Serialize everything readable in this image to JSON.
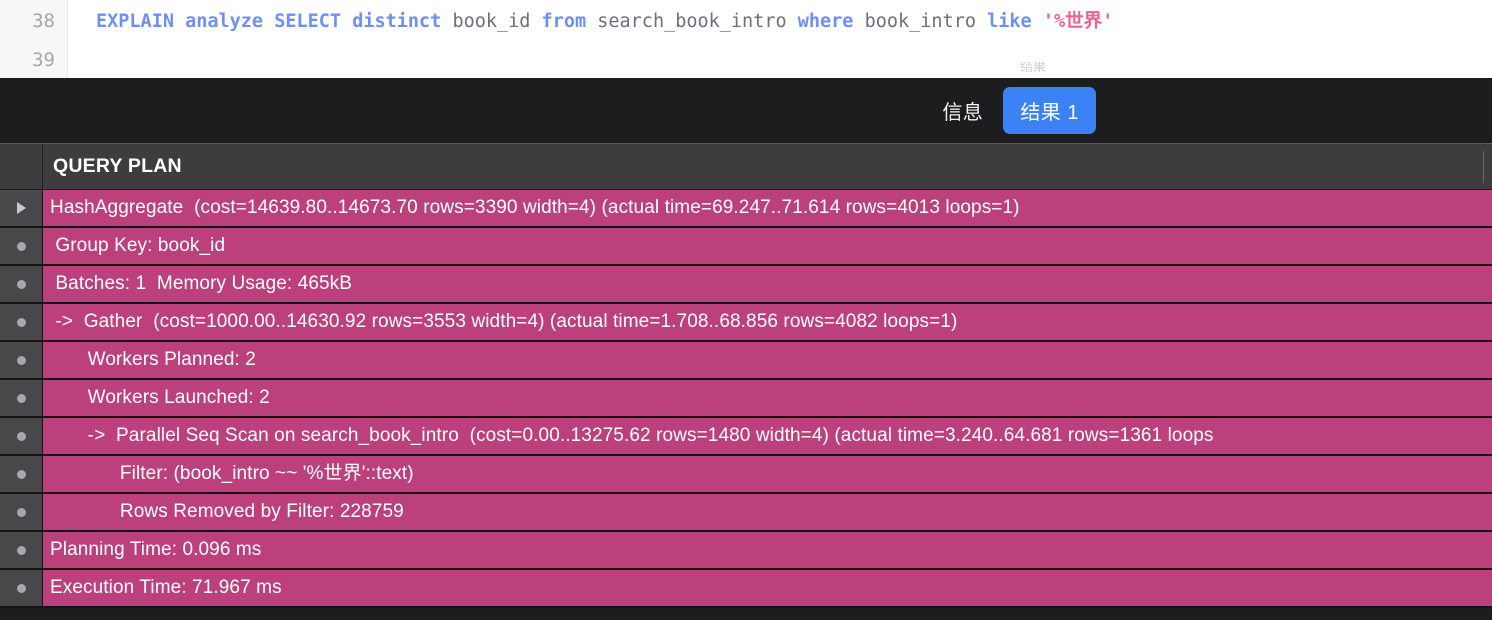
{
  "editor": {
    "line_numbers": [
      "38",
      "39"
    ],
    "sql_tokens": [
      {
        "t": "EXPLAIN",
        "c": "k"
      },
      {
        "t": " ",
        "c": "plain"
      },
      {
        "t": "analyze",
        "c": "k"
      },
      {
        "t": " ",
        "c": "plain"
      },
      {
        "t": "SELECT",
        "c": "k"
      },
      {
        "t": " ",
        "c": "plain"
      },
      {
        "t": "distinct",
        "c": "k"
      },
      {
        "t": " ",
        "c": "plain"
      },
      {
        "t": "book_id",
        "c": "id"
      },
      {
        "t": " ",
        "c": "plain"
      },
      {
        "t": "from",
        "c": "k"
      },
      {
        "t": " ",
        "c": "plain"
      },
      {
        "t": "search_book_intro",
        "c": "id"
      },
      {
        "t": " ",
        "c": "plain"
      },
      {
        "t": "where",
        "c": "k"
      },
      {
        "t": " ",
        "c": "plain"
      },
      {
        "t": "book_intro",
        "c": "id"
      },
      {
        "t": " ",
        "c": "plain"
      },
      {
        "t": "like",
        "c": "k"
      },
      {
        "t": " ",
        "c": "plain"
      },
      {
        "t": "'%世界'",
        "c": "str"
      }
    ],
    "sql_plain": "EXPLAIN analyze SELECT distinct book_id from search_book_intro where book_intro like '%世界'",
    "clipped_text_above_tabs": "结果"
  },
  "tabs": {
    "items": [
      {
        "label": "信息",
        "active": false
      },
      {
        "label": "结果 1",
        "active": true
      }
    ],
    "active_color": "#3b82f6",
    "bar_background": "#1d1d1f"
  },
  "result_grid": {
    "columns": [
      "QUERY PLAN"
    ],
    "selection_color": "#bc407c",
    "header_background": "#3d3d3f",
    "rows": [
      {
        "marker": "triangle-expand-icon",
        "text": "HashAggregate  (cost=14639.80..14673.70 rows=3390 width=4) (actual time=69.247..71.614 rows=4013 loops=1)"
      },
      {
        "marker": "dot-icon",
        "text": " Group Key: book_id"
      },
      {
        "marker": "dot-icon",
        "text": " Batches: 1  Memory Usage: 465kB"
      },
      {
        "marker": "dot-icon",
        "text": " ->  Gather  (cost=1000.00..14630.92 rows=3553 width=4) (actual time=1.708..68.856 rows=4082 loops=1)"
      },
      {
        "marker": "dot-icon",
        "text": "       Workers Planned: 2"
      },
      {
        "marker": "dot-icon",
        "text": "       Workers Launched: 2"
      },
      {
        "marker": "dot-icon",
        "text": "       ->  Parallel Seq Scan on search_book_intro  (cost=0.00..13275.62 rows=1480 width=4) (actual time=3.240..64.681 rows=1361 loops"
      },
      {
        "marker": "dot-icon",
        "text": "             Filter: (book_intro ~~ '%世界'::text)"
      },
      {
        "marker": "dot-icon",
        "text": "             Rows Removed by Filter: 228759"
      },
      {
        "marker": "dot-icon",
        "text": "Planning Time: 0.096 ms"
      },
      {
        "marker": "dot-icon",
        "text": "Execution Time: 71.967 ms"
      }
    ]
  }
}
